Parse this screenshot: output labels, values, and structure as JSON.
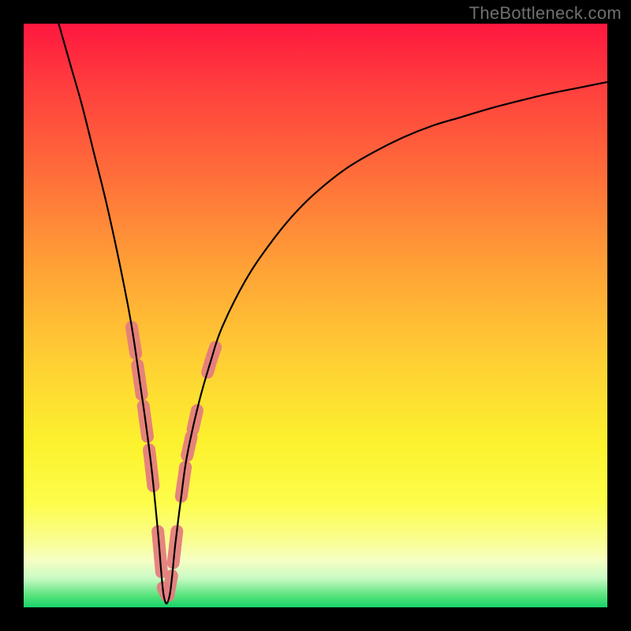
{
  "watermark": "TheBottleneck.com",
  "chart_data": {
    "type": "line",
    "title": "",
    "xlabel": "",
    "ylabel": "",
    "xlim": [
      0,
      100
    ],
    "ylim": [
      0,
      100
    ],
    "grid": false,
    "note": "V-shaped bottleneck curve over a vertical red→orange→yellow→green gradient. Minimum near x≈24. Values are visual estimates from an unlabeled chart.",
    "series": [
      {
        "name": "bottleneck-curve",
        "color": "#000000",
        "x": [
          6,
          8,
          10,
          12,
          14,
          16,
          18,
          19,
          20,
          21,
          22,
          23,
          24,
          25,
          26,
          27,
          28,
          30,
          32,
          34,
          38,
          42,
          46,
          50,
          55,
          60,
          65,
          70,
          75,
          80,
          85,
          90,
          95,
          100
        ],
        "y": [
          100,
          93,
          86,
          78,
          70,
          61,
          51,
          45,
          38,
          31,
          23,
          13,
          2,
          2,
          11,
          19,
          26,
          35,
          42,
          48,
          56,
          62,
          67,
          71,
          75,
          78,
          80.5,
          82.5,
          84,
          85.5,
          86.8,
          88,
          89,
          90
        ]
      }
    ],
    "highlight_segments": {
      "name": "salmon-overlay-dots",
      "color": "#e57e7e",
      "segments": [
        {
          "x_range": [
            18.5,
            22.5
          ],
          "side": "left"
        },
        {
          "x_range": [
            23.0,
            26.5
          ],
          "side": "bottom"
        },
        {
          "x_range": [
            27.0,
            30.0
          ],
          "side": "right"
        },
        {
          "x_range": [
            31.5,
            33.0
          ],
          "side": "right-upper"
        }
      ]
    }
  }
}
